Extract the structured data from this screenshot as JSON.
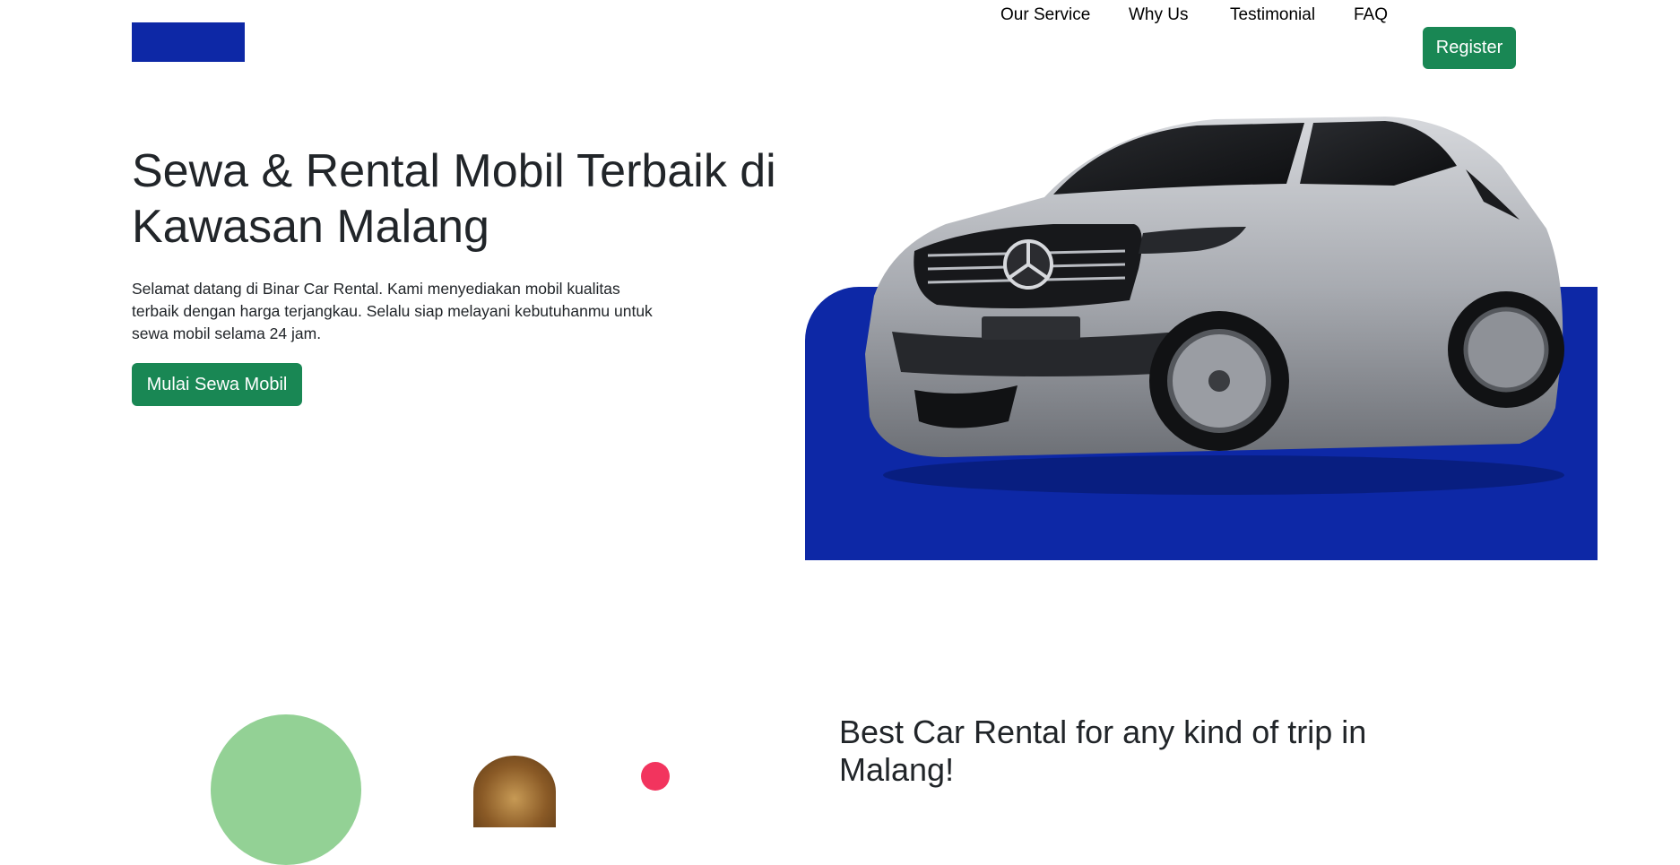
{
  "nav": {
    "items": [
      {
        "label": "Our Service"
      },
      {
        "label": "Why Us"
      },
      {
        "label": "Testimonial"
      },
      {
        "label": "FAQ"
      }
    ],
    "register_label": "Register"
  },
  "hero": {
    "title": "Sewa & Rental Mobil Terbaik di Kawasan Malang",
    "description": "Selamat datang di Binar Car Rental. Kami menyediakan mobil kualitas terbaik dengan harga terjangkau. Selalu siap melayani kebutuhanmu untuk sewa mobil selama 24 jam.",
    "cta_label": "Mulai Sewa Mobil"
  },
  "services": {
    "title": "Best Car Rental for any kind of trip in Malang!"
  },
  "colors": {
    "brand_blue": "#0d28a6",
    "button_green": "#198754",
    "accent_green": "#93d195",
    "accent_red": "#f2345e"
  }
}
